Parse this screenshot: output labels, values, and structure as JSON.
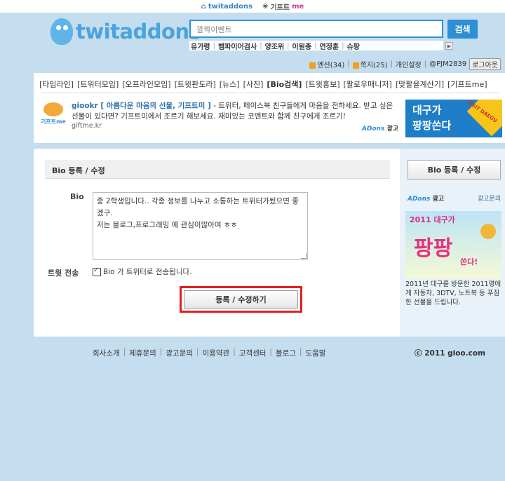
{
  "topbar": {
    "link1": "twitaddons",
    "link2_prefix": "기프트",
    "link2_suffix": "me"
  },
  "header": {
    "logo_text": "twitaddons",
    "search_placeholder": "깜짝이벤트",
    "search_button": "검색",
    "trending": [
      "유가령",
      "뱀파이어검사",
      "양조위",
      "이원종",
      "연정훈",
      "슈팡"
    ]
  },
  "userbar": {
    "mentions": "멘션(34)",
    "notes": "쪽지(25)",
    "settings": "개인설정",
    "user": "@PJM2839",
    "logout": "로그아웃"
  },
  "menu": [
    "[타임라인]",
    "[트위터모임]",
    "[오프라인모임]",
    "[트윗판도라]",
    "[뉴스]",
    "[사진]",
    "[Bio검색]",
    "[트윗홍보]",
    "[팔로우매니저]",
    "[맞팔율계산기]",
    "[기프트me]"
  ],
  "ad_top": {
    "logo_text": "기프트me",
    "headline": "giookr [ 아름다운 마음의 선물, 기프트미 ]",
    "body": " - 트위터, 페이스북 친구들에게 마음을 전하세요. 받고 싶은 선물이 있다면? 기프트미에서 조르기 해보세요. 재미있는 코멘트와 함께 친구에게 조르기!",
    "url": "giftme.kr",
    "adons": "ADons",
    "ad_label": "광고",
    "banner_line1": "대구가",
    "banner_line2": "팡팡쏜다",
    "banner_tag": "VISIT DAEGU"
  },
  "form": {
    "section_title": "Bio 등록 / 수정",
    "bio_label": "Bio",
    "bio_text": "중 2학생입니다.. 각종 정보를 나누고 소통하는 트위터가됬으면 좋겠구.\n저는 블로그,프로그래밍 에 관심이많아여 ㅎㅎ",
    "tweet_label": "트윗 전송",
    "checkbox_label": "Bio 가 트위터로 전송됩니다.",
    "submit_label": "등록 / 수정하기"
  },
  "sidebar": {
    "button": "Bio 등록 / 수정",
    "adons": "ADons",
    "ad_label": "광고",
    "ad_inquiry": "광고문의",
    "banner_year": "2011 대구가",
    "banner_big": "팡팡",
    "banner_small": "쏜다!",
    "ad_text": "2011년 대구를 방문한 2011명에게 자동차, 3DTV, 노트북 등 푸짐한 선물을 드립니다."
  },
  "footer": {
    "links": [
      "회사소개",
      "제휴문의",
      "광고문의",
      "이용약관",
      "고객센터",
      "블로그",
      "도움말"
    ],
    "copyright": "ⓒ 2011 gioo.com"
  }
}
